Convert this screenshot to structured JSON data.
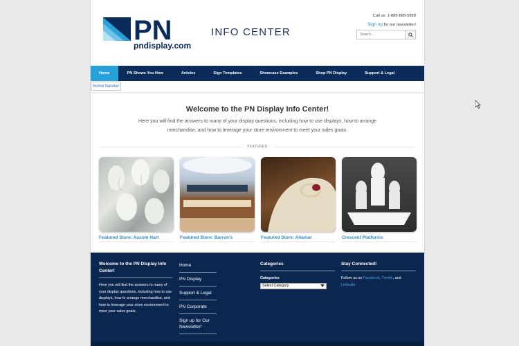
{
  "header": {
    "logo_text": "PN",
    "logo_sub": "pndisplay.com",
    "site_title": "INFO CENTER",
    "call_us": "Call us: 1-888-888-5888",
    "signup_link": "Sign up",
    "signup_rest": " for our newsletter!",
    "search_placeholder": "Search..."
  },
  "nav": {
    "items": [
      "Home",
      "PN Shows You How",
      "Articles",
      "Sign Templates",
      "Showcase Examples",
      "Shop PN Display",
      "Support & Legal"
    ]
  },
  "banner": {
    "alt_text": "home banner"
  },
  "welcome": {
    "heading": "Welcome to the PN Display Info Center!",
    "body": "Here you will find the answers to many of your display questions, including how to use displays, how to arrange merchandise, and how to leverage your store environment to meet your sales goals."
  },
  "featured": {
    "label": "FEATURED",
    "cards": [
      {
        "label": "Featured Store: Aucoin Hart"
      },
      {
        "label": "Featured Store: Barron's"
      },
      {
        "label": "Featured Store: Altamar"
      },
      {
        "label": "Crescent Platforms"
      }
    ]
  },
  "footer": {
    "col1": {
      "title": "Welcome to the PN Display Info Center!",
      "body": "Here you will find the answers to many of your display questions, including how to use displays, how to arrange merchandise, and how to leverage your store environment to meet your sales goals."
    },
    "links": [
      "Home",
      "PN Display",
      "Support & Legal",
      "PN Corporate",
      "Sign up for Our Newsletter!"
    ],
    "categories": {
      "title": "Categories",
      "label": "Categories",
      "select_value": "Select Category"
    },
    "connect": {
      "title": "Stay Connected!",
      "prefix": "Follow us on ",
      "facebook": "Facebook",
      "sep1": ", ",
      "tumblr": "Tumblr",
      "sep2": ", and ",
      "linkedin": "LinkedIn"
    }
  },
  "colors": {
    "navy": "#0b2b5a",
    "accent": "#27a1d9",
    "link": "#2a8bd1"
  }
}
